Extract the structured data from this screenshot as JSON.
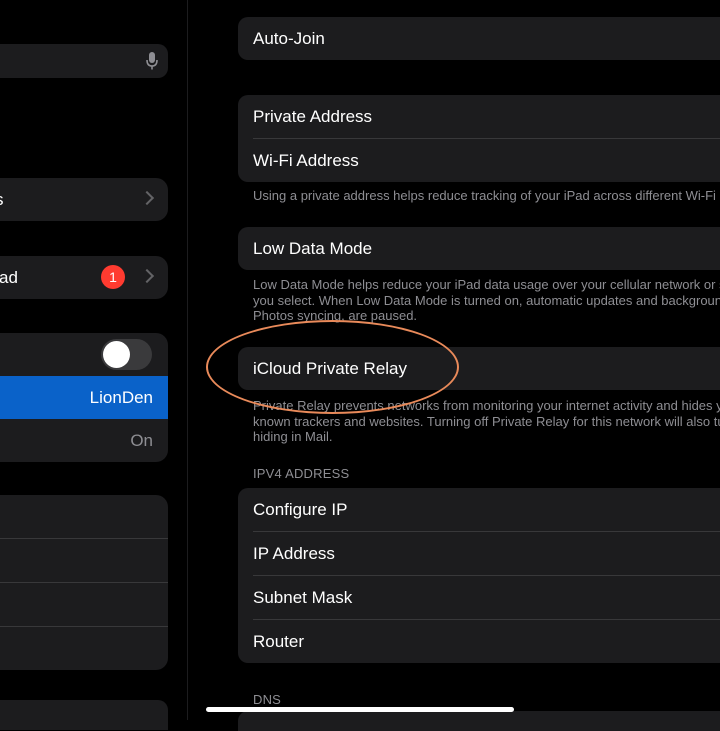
{
  "sidebar": {
    "row_services_label": "s",
    "row_ipad_label": "ad",
    "row_ipad_badge": "1",
    "wifi_toggle_on": false,
    "network_name": "LionDen",
    "bluetooth_value": "On"
  },
  "detail": {
    "auto_join_label": "Auto-Join",
    "private_address_label": "Private Address",
    "wifi_address_label": "Wi-Fi Address",
    "private_address_note": "Using a private address helps reduce tracking of your iPad across different Wi-Fi networks.",
    "low_data_mode_label": "Low Data Mode",
    "low_data_note_1": "Low Data Mode helps reduce your iPad data usage over your cellular network or specific Wi-Fi networks",
    "low_data_note_2": "you select. When Low Data Mode is turned on, automatic updates and background tasks, such as",
    "low_data_note_3": "Photos syncing, are paused.",
    "private_relay_label": "iCloud Private Relay",
    "relay_note_1": "Private Relay prevents networks from monitoring your internet activity and hides your IP address from",
    "relay_note_2": "known trackers and websites. Turning off Private Relay for this network will also turn off IP address",
    "relay_note_3": "hiding in Mail.",
    "ipv4_header": "IPV4 ADDRESS",
    "configure_ip_label": "Configure IP",
    "ip_address_label": "IP Address",
    "subnet_mask_label": "Subnet Mask",
    "router_label": "Router",
    "dns_header": "DNS"
  },
  "colors": {
    "accent": "#0a62c9",
    "badge": "#ff3b30",
    "annotation": "#e98a5a"
  }
}
